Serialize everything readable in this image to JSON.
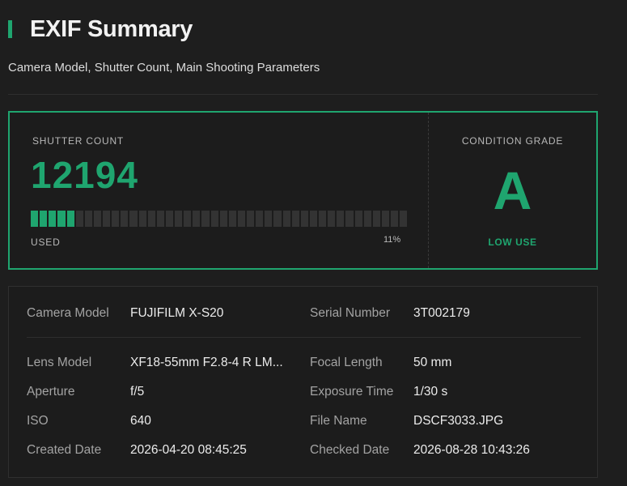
{
  "header": {
    "title": "EXIF Summary",
    "subtitle": "Camera Model, Shutter Count, Main Shooting Parameters"
  },
  "shutter": {
    "label": "SHUTTER COUNT",
    "value": "12194",
    "used_label": "USED",
    "used_fraction": 0.11,
    "percent_text": "11%"
  },
  "condition": {
    "label": "CONDITION GRADE",
    "grade": "A",
    "note": "LOW USE"
  },
  "details": {
    "camera_model_key": "Camera Model",
    "camera_model_val": "FUJIFILM X-S20",
    "serial_key": "Serial Number",
    "serial_val": "3T002179",
    "lens_key": "Lens Model",
    "lens_val": "XF18-55mm F2.8-4 R LM...",
    "focal_key": "Focal Length",
    "focal_val": "50 mm",
    "aperture_key": "Aperture",
    "aperture_val": "f/5",
    "exposure_key": "Exposure Time",
    "exposure_val": "1/30 s",
    "iso_key": "ISO",
    "iso_val": "640",
    "filename_key": "File Name",
    "filename_val": "DSCF3033.JPG",
    "created_key": "Created Date",
    "created_val": "2026-04-20 08:45:25",
    "checked_key": "Checked Date",
    "checked_val": "2026-08-28 10:43:26"
  },
  "colors": {
    "accent": "#1fa56f",
    "background": "#1e1e1e",
    "card": "#1c1c1c"
  }
}
